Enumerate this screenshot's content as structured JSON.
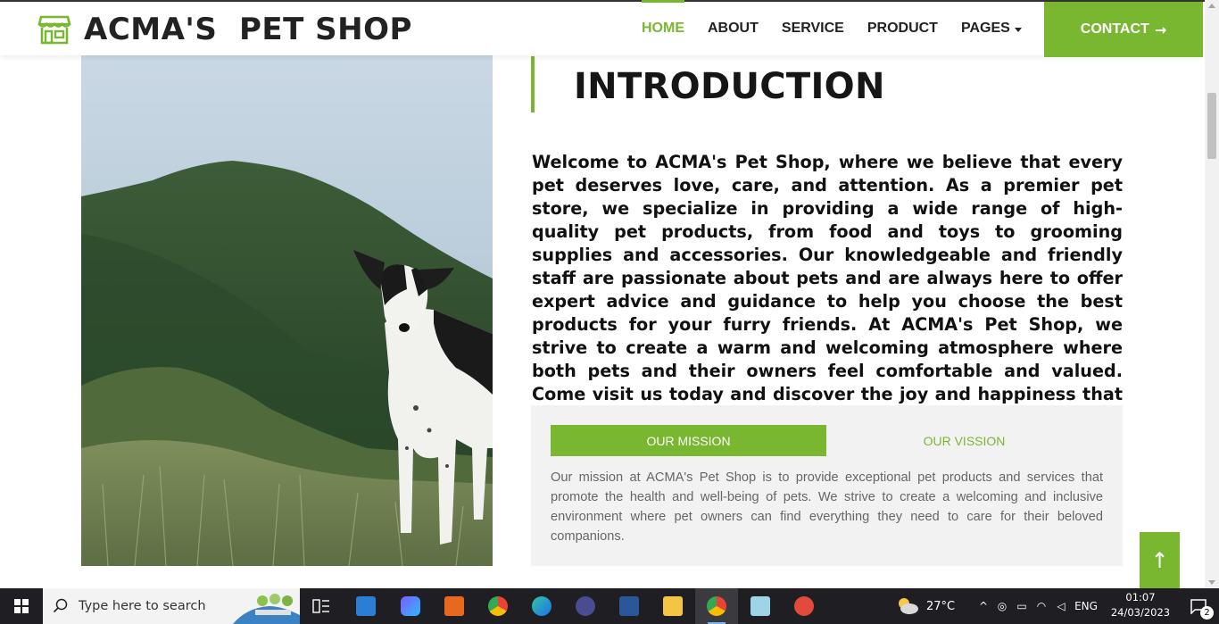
{
  "brand": {
    "name": "ACMA'S  PET SHOP",
    "icon": "storefront-icon"
  },
  "nav": {
    "items": [
      {
        "label": "HOME",
        "active": true
      },
      {
        "label": "ABOUT",
        "active": false
      },
      {
        "label": "SERVICE",
        "active": false
      },
      {
        "label": "PRODUCT",
        "active": false
      },
      {
        "label": "PAGES",
        "active": false,
        "dropdown": true
      }
    ],
    "contact_label": "CONTACT",
    "contact_arrow": "→"
  },
  "intro": {
    "title": "INTRODUCTION",
    "text": "Welcome to ACMA's Pet Shop, where we believe that every pet deserves love, care, and attention. As a premier pet store, we specialize in providing a wide range of high-quality pet products, from food and toys to grooming supplies and accessories. Our knowledgeable and friendly staff are passionate about pets and are always here to offer expert advice and guidance to help you choose the best products for your furry friends. At ACMA's Pet Shop, we strive to create a warm and welcoming atmosphere where both pets and their owners feel comfortable and valued. Come visit us today and discover the joy and happiness that a pet can bring into your life."
  },
  "tabs": {
    "items": [
      {
        "label": "OUR MISSION",
        "active": true
      },
      {
        "label": "OUR VISSION",
        "active": false
      }
    ],
    "content": "Our mission at ACMA's Pet Shop is to provide exceptional pet products and services that promote the health and well-being of pets. We strive to create a welcoming and inclusive environment where pet owners can find everything they need to care for their beloved companions."
  },
  "back_to_top": {
    "icon": "arrow-up-icon",
    "glyph": "↑"
  },
  "colors": {
    "accent": "#7ab730",
    "text_dark": "#111111",
    "taskbar": "#1f1f23"
  },
  "taskbar": {
    "search_placeholder": "Type here to search",
    "apps": [
      "task-view",
      "mail",
      "copilot",
      "office",
      "chrome",
      "edge",
      "terminal",
      "word",
      "file-explorer",
      "chrome-profile",
      "notepad",
      "paint"
    ],
    "weather": "27°C",
    "language": "ENG",
    "time": "01:07",
    "date": "24/03/2023",
    "notifications": "2"
  }
}
